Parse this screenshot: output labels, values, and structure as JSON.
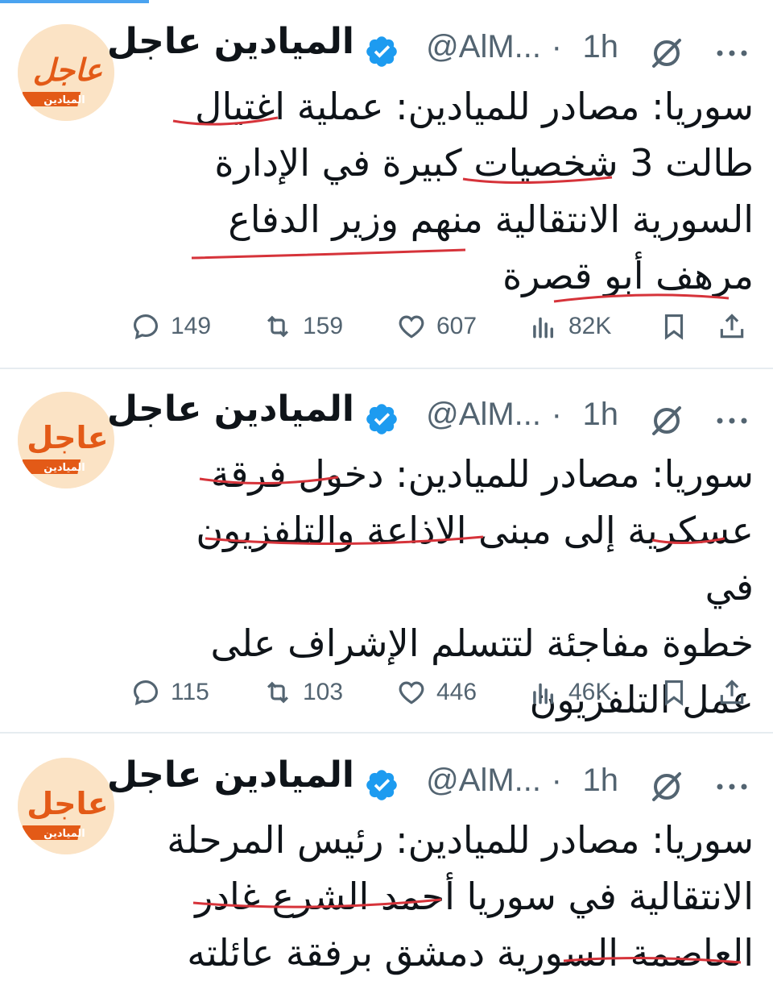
{
  "account": {
    "name": "الميادين عاجل",
    "handle": "@AlM...",
    "dot": "·",
    "avatar_line1": "عاجل",
    "avatar_line2": "الميادين"
  },
  "colors": {
    "accent": "#e35a17",
    "underline": "#d6333a",
    "verified": "#1d9bf0"
  },
  "tweets": [
    {
      "time": "1h",
      "text": "سوريا: مصادر للميادين: عملية اغتيال\nطالت 3 شخصيات كبيرة في الإدارة\nالسورية الانتقالية منهم وزير الدفاع\nمرهف أبو قصرة",
      "replies": "149",
      "reposts": "159",
      "likes": "607",
      "views": "82K"
    },
    {
      "time": "1h",
      "text": "سوريا: مصادر للميادين: دخول فرقة\nعسكرية إلى مبنى الاذاعة والتلفزيون في\nخطوة مفاجئة لتتسلم الإشراف على\nعمل التلفزيون",
      "replies": "115",
      "reposts": "103",
      "likes": "446",
      "views": "46K"
    },
    {
      "time": "1h",
      "text": "سوريا: مصادر للميادين: رئيس المرحلة\nالانتقالية في سوريا أحمد الشرع غادر\nالعاصمة السورية دمشق برفقة عائلته",
      "replies": "",
      "reposts": "",
      "likes": "",
      "views": ""
    }
  ],
  "icons": [
    "verified-badge-icon",
    "grok-icon",
    "more-icon",
    "reply-icon",
    "repost-icon",
    "like-icon",
    "views-icon",
    "bookmark-icon",
    "share-icon"
  ]
}
